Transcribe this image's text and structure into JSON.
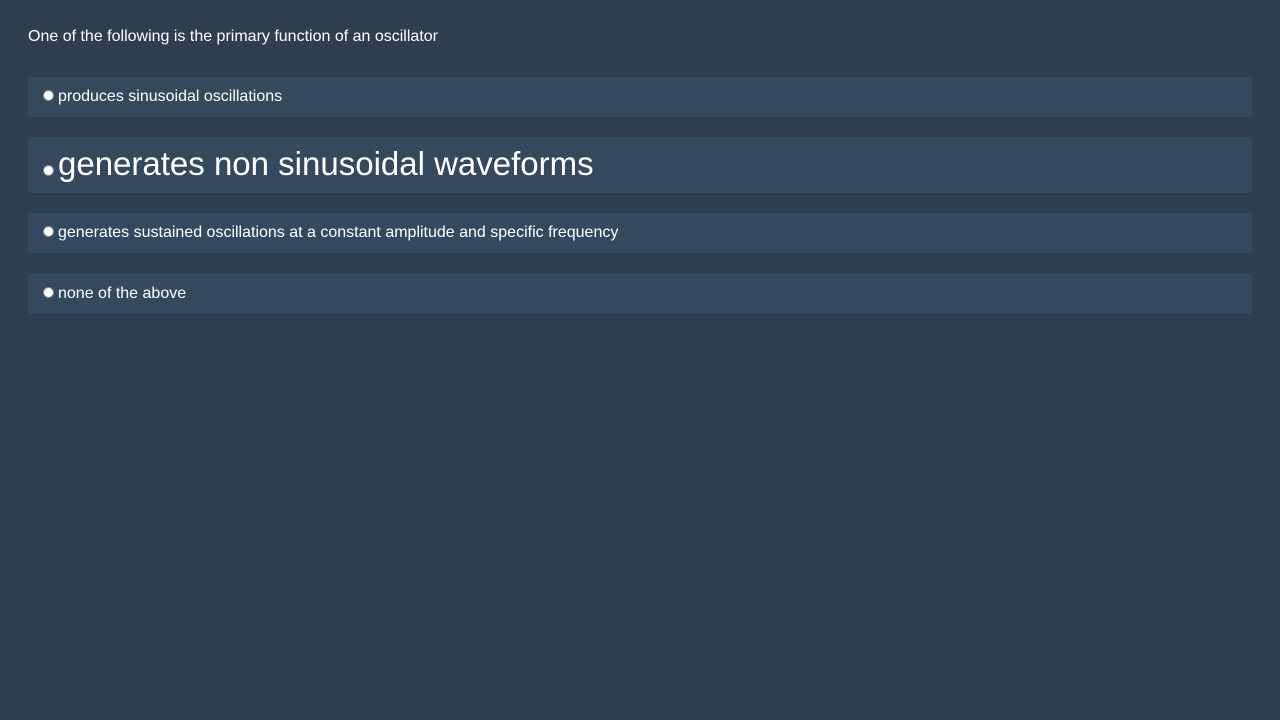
{
  "question": {
    "text": "One of the following is the primary function of an oscillator"
  },
  "options": [
    {
      "label": "produces sinusoidal oscillations"
    },
    {
      "label": "generates non sinusoidal waveforms"
    },
    {
      "label": "generates sustained oscillations at a constant amplitude and specific frequency"
    },
    {
      "label": "none of the above"
    }
  ],
  "colors": {
    "background": "#2e3d4f",
    "option_background": "#34495e",
    "text": "#ffffff"
  }
}
